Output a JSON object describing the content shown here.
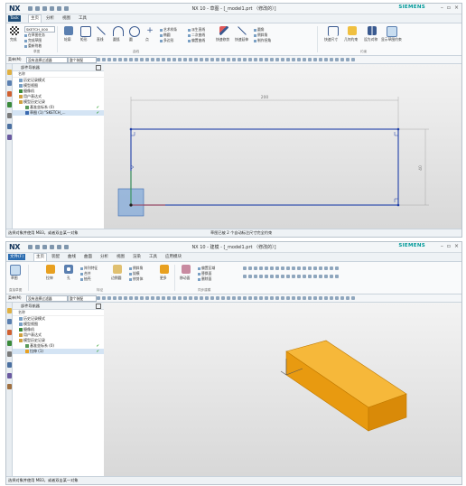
{
  "colors": {
    "accent": "#1f4e79",
    "siemens": "#009999",
    "sketch": "#1f3fa8",
    "block": "#f2a618",
    "check": "#2a9d2a"
  },
  "sketch_window": {
    "app": "NX",
    "title": "NX 10 - 草图 - [_model1.prt （修改的）]",
    "brand": "SIEMENS",
    "tabs": [
      "Task",
      "主页",
      "分析",
      "视图",
      "工具"
    ],
    "active_tab": "主页",
    "sketch_combo": "SKETCH_000",
    "ribbon": {
      "finish": "完成",
      "small": [
        "在草图任务",
        "完成草图",
        "重新附着"
      ],
      "curve_buttons": [
        "轮廓",
        "矩形",
        "直线",
        "圆弧",
        "圆",
        "点"
      ],
      "curve_small": [
        "艺术样条",
        "椭圆",
        "多边形"
      ],
      "edit_small": [
        "派生直线",
        "二次曲线",
        "偏置曲线"
      ],
      "edit_buttons": [
        "快速修剪",
        "快速延伸"
      ],
      "edit_small2": [
        "圆角",
        "倒斜角",
        "制作拐角"
      ],
      "constraint_buttons": [
        "快速尺寸",
        "几何约束",
        "设为对称",
        "显示草图约束"
      ],
      "groups": [
        "草图",
        "曲线",
        "约束"
      ]
    },
    "selection": {
      "menu": "菜单(M)",
      "filter": "没有选择过滤器",
      "scope": "整个装配"
    },
    "navigator": {
      "title": "部件导航器",
      "column": "名称",
      "rows": [
        {
          "label": "历史记录模式",
          "check": ""
        },
        {
          "label": "模型视图",
          "check": ""
        },
        {
          "label": "摄像机",
          "check": ""
        },
        {
          "label": "用户表达式",
          "check": ""
        },
        {
          "label": "模型历史记录",
          "check": ""
        },
        {
          "label": "基准坐标系 (0)",
          "check": "✔"
        },
        {
          "label": "草图 (1) \"SKETCH_...",
          "check": "✔"
        }
      ]
    },
    "dimension_labels": [
      "200",
      "40"
    ],
    "status_left": "选择对象并使用 MB3，或者双击某一对象",
    "status_mid": "草图已被 2 个自动标注尺寸完全约束"
  },
  "model_window": {
    "app": "NX",
    "title": "NX 10 - 建模 - [_model1.prt （修改的）]",
    "brand": "SIEMENS",
    "tabs": [
      "文件(F)",
      "主页",
      "装配",
      "曲线",
      "曲面",
      "分析",
      "视图",
      "渲染",
      "工具",
      "应用模块"
    ],
    "active_tab": "主页",
    "ribbon": {
      "buttons": [
        "草图",
        "拉伸",
        "孔",
        "阵列特征",
        "合并",
        "抽壳",
        "边倒圆",
        "更多",
        "移动面"
      ],
      "small": [
        "阵列特征",
        "合并",
        "抽壳"
      ],
      "small2": [
        "倒斜角",
        "拔模",
        "修剪体"
      ],
      "small3": [
        "偏置区域",
        "替换面",
        "删除面"
      ],
      "groups": [
        "直接草图",
        "特征",
        "同步建模"
      ]
    },
    "selection": {
      "menu": "菜单(M)",
      "filter": "没有选择过滤器",
      "scope": "整个装配"
    },
    "navigator": {
      "title": "部件导航器",
      "column": "名称",
      "rows": [
        {
          "label": "历史记录模式",
          "check": ""
        },
        {
          "label": "模型视图",
          "check": ""
        },
        {
          "label": "摄像机",
          "check": ""
        },
        {
          "label": "用户表达式",
          "check": ""
        },
        {
          "label": "模型历史记录",
          "check": ""
        },
        {
          "label": "基准坐标系 (0)",
          "check": "✔"
        },
        {
          "label": "拉伸 (1)",
          "check": "✔"
        }
      ]
    },
    "status_left": "选择对象并使用 MB3，或者双击某一对象"
  }
}
